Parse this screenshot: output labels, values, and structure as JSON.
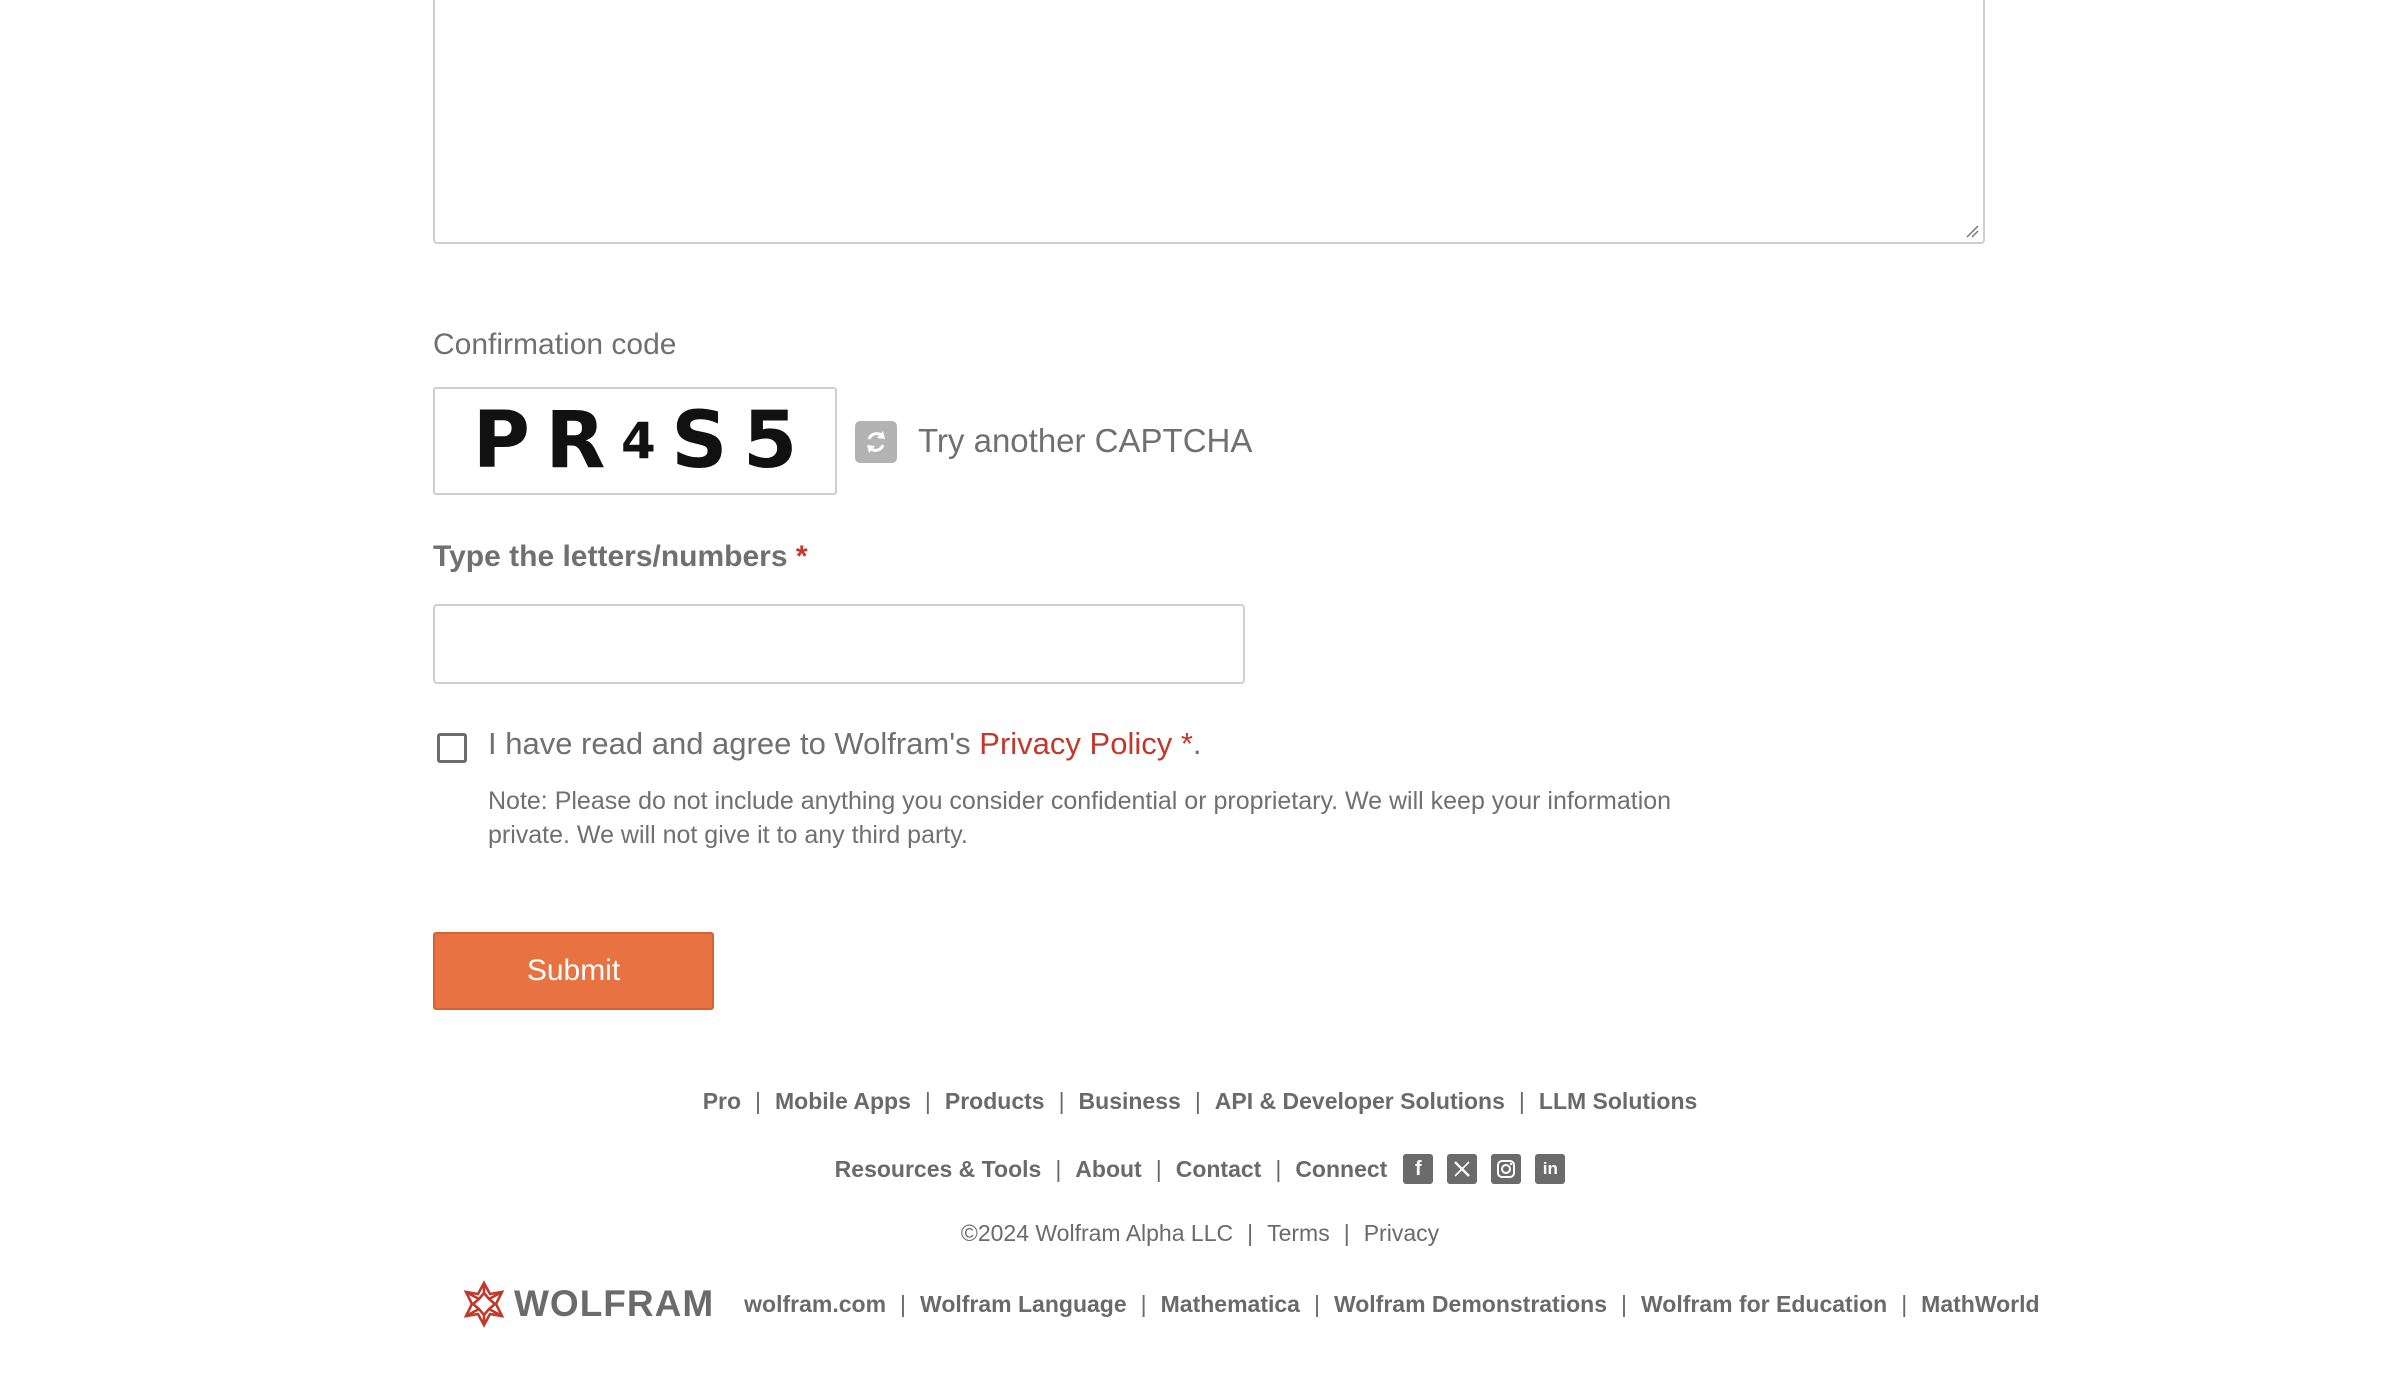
{
  "form": {
    "confirmation_label": "Confirmation code",
    "captcha_chars": [
      "P",
      "R",
      "4",
      "S",
      "5"
    ],
    "try_another": "Try another CAPTCHA",
    "type_label": "Type the letters/numbers",
    "required_marker": "*",
    "input_value": "",
    "agree_prefix": "I have read and agree to Wolfram's ",
    "privacy_link": "Privacy Policy *",
    "agree_suffix": ".",
    "note": "Note: Please do not include anything you consider confidential or proprietary. We will keep your information private. We will not give it to any third party.",
    "submit_label": "Submit"
  },
  "footer": {
    "row1": [
      "Pro",
      "Mobile Apps",
      "Products",
      "Business",
      "API & Developer Solutions",
      "LLM Solutions"
    ],
    "row2": [
      "Resources & Tools",
      "About",
      "Contact",
      "Connect"
    ],
    "social_icons": [
      "facebook-icon",
      "x-twitter-icon",
      "instagram-icon",
      "linkedin-icon"
    ],
    "copyright": "©2024  Wolfram Alpha LLC",
    "legal": [
      "Terms",
      "Privacy"
    ],
    "logo_text": "WOLFRAM",
    "bottom_links": [
      "wolfram.com",
      "Wolfram Language",
      "Mathematica",
      "Wolfram Demonstrations",
      "Wolfram for Education",
      "MathWorld"
    ]
  },
  "colors": {
    "accent_red": "#c0392b",
    "submit_orange": "#e87242",
    "text_gray": "#707070"
  }
}
